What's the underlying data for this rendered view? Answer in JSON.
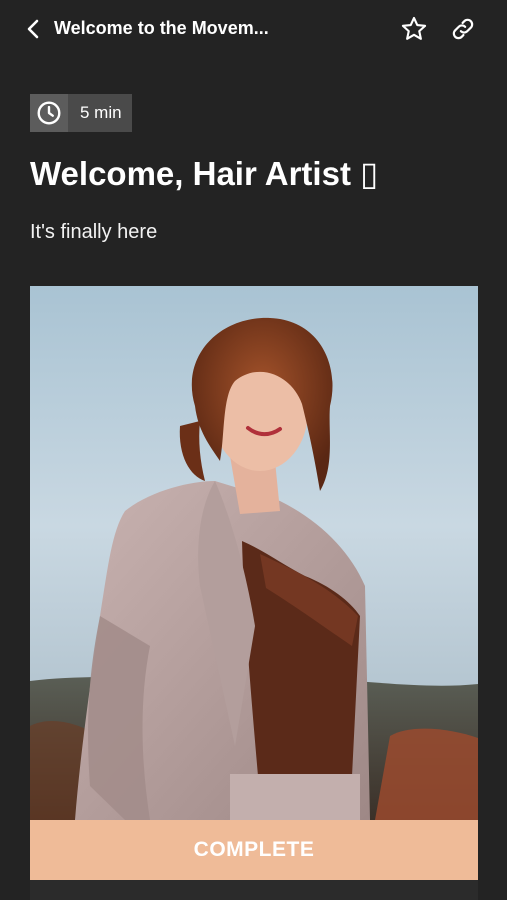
{
  "header": {
    "back_icon": "chevron-left-icon",
    "title": "Welcome to the Movem...",
    "favorite_icon": "star-outline-icon",
    "share_icon": "link-icon"
  },
  "lesson": {
    "duration_icon": "clock-icon",
    "duration": "5 min",
    "title": "Welcome, Hair Artist ▯",
    "subtitle": "It's finally here"
  },
  "hero_image": {
    "subject": "photo-portrait"
  },
  "actions": {
    "complete_label": "COMPLETE"
  },
  "colors": {
    "background": "#232323",
    "accent": "#efbb98",
    "badge_bg": "#4a4a4a"
  }
}
